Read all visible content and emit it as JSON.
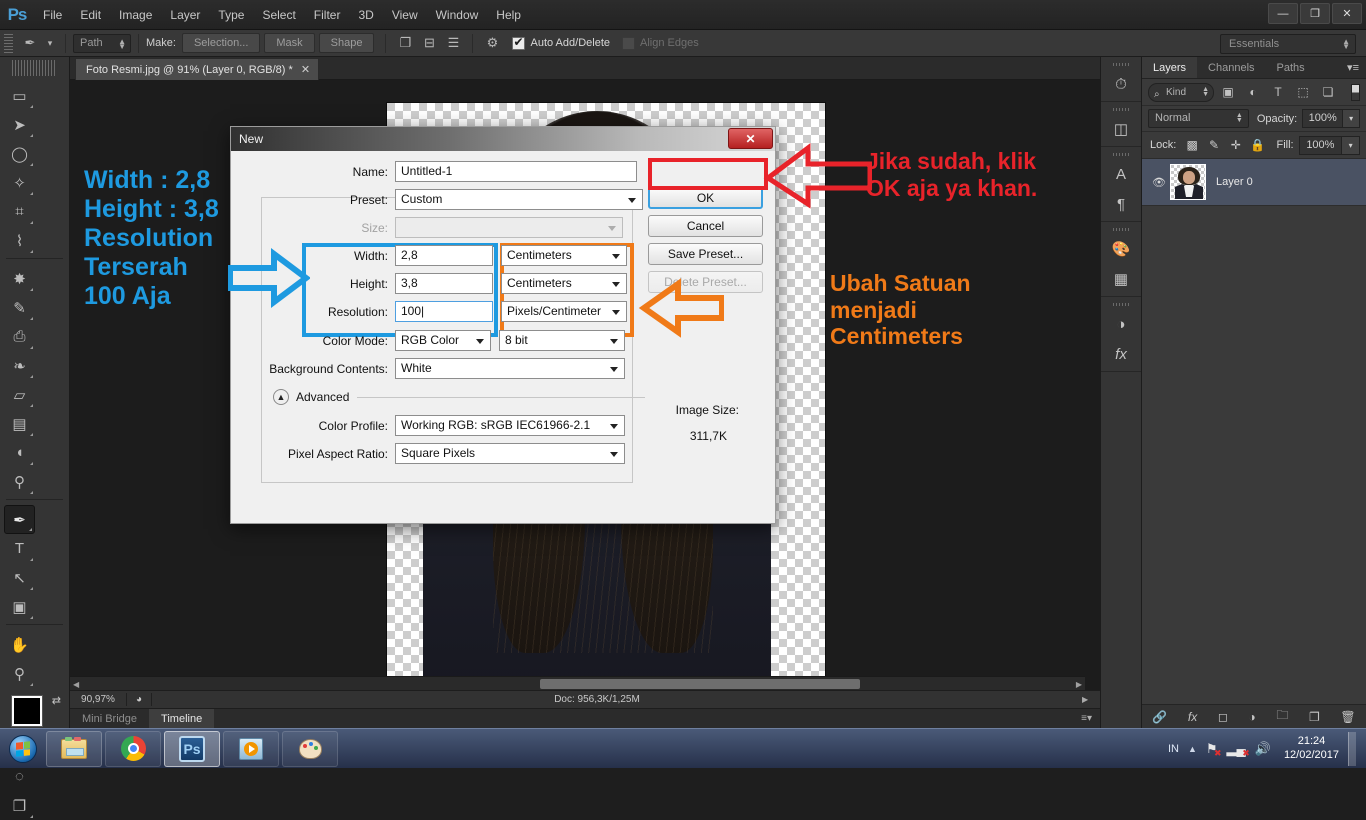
{
  "app": {
    "logo": "Ps",
    "menus": [
      "File",
      "Edit",
      "Image",
      "Layer",
      "Type",
      "Select",
      "Filter",
      "3D",
      "View",
      "Window",
      "Help"
    ],
    "window_controls": {
      "minimize": "—",
      "maximize": "❐",
      "close": "✕"
    },
    "workspace": "Essentials"
  },
  "options_bar": {
    "tool_icon": "pen-tool-icon",
    "mode_value": "Path",
    "make_label": "Make:",
    "buttons": [
      "Selection...",
      "Mask",
      "Shape"
    ],
    "path_ops_icons": [
      "path-operations-icon",
      "path-alignment-icon",
      "path-arrangement-icon",
      "gear-icon"
    ],
    "auto_add_delete": {
      "label": "Auto Add/Delete",
      "checked": true
    },
    "align_edges": {
      "label": "Align Edges",
      "checked": false,
      "disabled": true
    }
  },
  "toolbar": {
    "tools": [
      {
        "name": "marquee-tool",
        "glyph": "▭"
      },
      {
        "name": "move-tool",
        "glyph": "➤"
      },
      {
        "name": "lasso-tool",
        "glyph": "◯"
      },
      {
        "name": "quick-selection-tool",
        "glyph": "✧"
      },
      {
        "name": "crop-tool",
        "glyph": "⌗"
      },
      {
        "name": "eyedropper-tool",
        "glyph": "⌇"
      },
      {
        "name": "spot-healing-tool",
        "glyph": "✸"
      },
      {
        "name": "brush-tool",
        "glyph": "✎"
      },
      {
        "name": "clone-stamp-tool",
        "glyph": "⎙"
      },
      {
        "name": "history-brush-tool",
        "glyph": "❧"
      },
      {
        "name": "eraser-tool",
        "glyph": "▱"
      },
      {
        "name": "gradient-tool",
        "glyph": "▤"
      },
      {
        "name": "blur-tool",
        "glyph": "💧"
      },
      {
        "name": "dodge-tool",
        "glyph": "🔍"
      },
      {
        "name": "pen-tool",
        "glyph": "✒",
        "active": true
      },
      {
        "name": "type-tool",
        "glyph": "T"
      },
      {
        "name": "path-selection-tool",
        "glyph": "↖"
      },
      {
        "name": "rectangle-tool",
        "glyph": "▣"
      },
      {
        "name": "hand-tool",
        "glyph": "✋"
      },
      {
        "name": "zoom-tool",
        "glyph": "🔍"
      }
    ],
    "foreground_color": "#000000",
    "background_color": "#ffffff",
    "swap_icon": "swap-colors-icon",
    "default_icon": "default-colors-icon",
    "quick_mask_icon": "quick-mask-icon",
    "screen_mode_icon": "screen-mode-icon"
  },
  "document_tab": {
    "title": "Foto Resmi.jpg @ 91% (Layer 0, RGB/8) *",
    "close": "✕"
  },
  "status_bar": {
    "zoom": "90,97%",
    "doc_info": "Doc: 956,3K/1,25M"
  },
  "bottom_tabs": [
    {
      "label": "Mini Bridge",
      "active": false
    },
    {
      "label": "Timeline",
      "active": true
    }
  ],
  "right_rail": {
    "groups": [
      [
        "history-icon"
      ],
      [
        "adjustments-icon"
      ],
      [
        "character-icon",
        "paragraph-icon"
      ],
      [
        "color-icon",
        "swatches-icon"
      ],
      [
        "adjustment-layer-icon",
        "styles-icon"
      ]
    ]
  },
  "layers_panel": {
    "tabs": [
      {
        "label": "Layers",
        "active": true
      },
      {
        "label": "Channels",
        "active": false
      },
      {
        "label": "Paths",
        "active": false
      }
    ],
    "menu_icon": "panel-menu-icon",
    "filter": {
      "kind_label": "Kind",
      "search_icon": "search-icon",
      "type_icons": [
        "pixel-filter-icon",
        "adjustment-filter-icon",
        "type-filter-icon",
        "shape-filter-icon",
        "smart-object-filter-icon"
      ]
    },
    "blend_mode": "Normal",
    "opacity_label": "Opacity:",
    "opacity_value": "100%",
    "lock_label": "Lock:",
    "lock_icons": [
      "lock-transparent-pixels-icon",
      "lock-image-pixels-icon",
      "lock-position-icon",
      "lock-all-icon"
    ],
    "fill_label": "Fill:",
    "fill_value": "100%",
    "layers": [
      {
        "name": "Layer 0",
        "visible": true,
        "selected": true,
        "eye_icon": "eye-icon"
      }
    ],
    "bottom_icons": [
      "link-layers-icon",
      "layer-style-icon",
      "layer-mask-icon",
      "new-adjustment-layer-icon",
      "new-group-icon",
      "new-layer-icon",
      "delete-layer-icon"
    ]
  },
  "dialog": {
    "title": "New",
    "close": "✕",
    "name_label": "Name:",
    "name_value": "Untitled-1",
    "preset_label": "Preset:",
    "preset_value": "Custom",
    "size_label": "Size:",
    "size_value": "",
    "width_label": "Width:",
    "width_value": "2,8",
    "width_unit": "Centimeters",
    "height_label": "Height:",
    "height_value": "3,8",
    "height_unit": "Centimeters",
    "resolution_label": "Resolution:",
    "resolution_value": "100",
    "resolution_unit": "Pixels/Centimeter",
    "color_mode_label": "Color Mode:",
    "color_mode_value": "RGB Color",
    "bit_depth_value": "8 bit",
    "background_label": "Background Contents:",
    "background_value": "White",
    "advanced_label": "Advanced",
    "advanced_toggle_icon": "collapse-icon",
    "color_profile_label": "Color Profile:",
    "color_profile_value": "Working RGB:  sRGB IEC61966-2.1",
    "pixel_aspect_label": "Pixel Aspect Ratio:",
    "pixel_aspect_value": "Square Pixels",
    "image_size_label": "Image Size:",
    "image_size_value": "311,7K",
    "buttons": {
      "ok": "OK",
      "cancel": "Cancel",
      "save_preset": "Save Preset...",
      "delete_preset": "Delete Preset..."
    }
  },
  "annotations": {
    "blue_text": "Width : 2,8\nHeight : 3,8\nResolution\nTerserah\n100 Aja",
    "blue_color": "#1e9ae0",
    "red_text": "Jika sudah, klik\nOK aja ya khan.",
    "red_color": "#e8232a",
    "orange_text": "Ubah Satuan\nmenjadi\nCentimeters",
    "orange_color": "#f07a18"
  },
  "taskbar": {
    "start_icon": "windows-start-icon",
    "apps": [
      {
        "name": "file-explorer-icon",
        "active": false
      },
      {
        "name": "google-chrome-icon",
        "active": false
      },
      {
        "name": "photoshop-icon",
        "active": true,
        "label": "Ps"
      },
      {
        "name": "media-player-icon",
        "active": false
      },
      {
        "name": "paint-icon",
        "active": false
      }
    ],
    "language": "IN",
    "tray_icons": [
      "show-hidden-icons-icon",
      "network-error-icon",
      "signal-error-icon",
      "volume-icon"
    ],
    "time": "21:24",
    "date": "12/02/2017"
  }
}
